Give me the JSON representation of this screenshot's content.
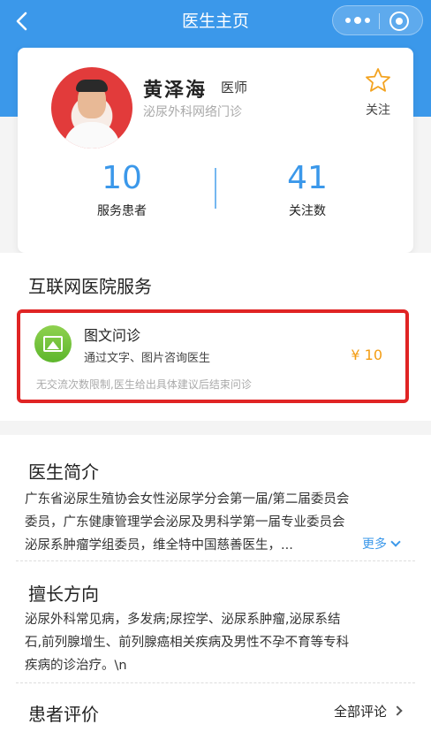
{
  "nav": {
    "title": "医生主页",
    "back_icon": "chevron-left-icon"
  },
  "capsule": {
    "more_icon": "more-dots-icon",
    "close_icon": "target-circle-icon"
  },
  "doctor": {
    "name": "黄泽海",
    "title": "医师",
    "department": "泌尿外科网络门诊",
    "follow_label": "关注",
    "follow_icon": "star-outline-icon"
  },
  "stats": [
    {
      "value": "10",
      "label": "服务患者"
    },
    {
      "value": "41",
      "label": "关注数"
    }
  ],
  "services": {
    "section_title": "互联网医院服务",
    "item": {
      "name": "图文问诊",
      "desc": "通过文字、图片咨询医生",
      "price": "¥ 10",
      "note": "无交流次数限制,医生给出具体建议后结束问诊",
      "icon": "image-icon"
    }
  },
  "intro": {
    "title": "医生简介",
    "lines": [
      "广东省泌尿生殖协会女性泌尿学分会第一届/第二届委员会",
      "委员，广东健康管理学会泌尿及男科学第一届专业委员会",
      "泌尿系肿瘤学组委员，维全特中国慈善医生，..."
    ],
    "more_label": "更多"
  },
  "specialty": {
    "title": "擅长方向",
    "lines": [
      "泌尿外科常见病，多发病;尿控学、泌尿系肿瘤,泌尿系结",
      "石,前列腺增生、前列腺癌相关疾病及男性不孕不育等专科",
      "疾病的诊治疗。\\n"
    ]
  },
  "reviews": {
    "title": "患者评价",
    "all_label": "全部评论"
  },
  "colors": {
    "brand_blue": "#3b98ea",
    "price_orange": "#f39c12",
    "highlight_red": "#e02424",
    "star": "#f3a320"
  }
}
